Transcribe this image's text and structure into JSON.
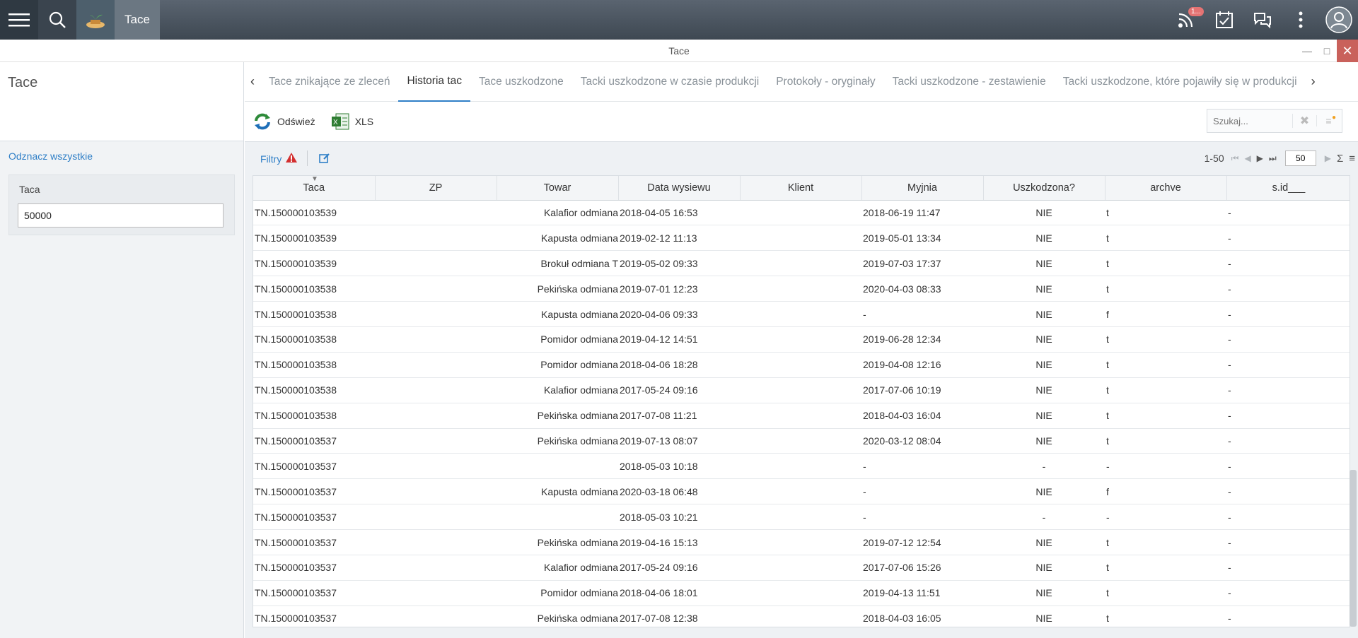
{
  "topbar": {
    "app_tab": "Tace",
    "notification_badge": "1..."
  },
  "window": {
    "title": "Tace"
  },
  "left": {
    "title": "Tace",
    "deselect_all": "Odznacz wszystkie",
    "filter_label": "Taca",
    "filter_value": "50000"
  },
  "tabs": [
    "Tace znikające ze zleceń",
    "Historia tac",
    "Tace uszkodzone",
    "Tacki uszkodzone w czasie produkcji",
    "Protokoły - oryginały",
    "Tacki uszkodzone - zestawienie",
    "Tacki uszkodzone, które pojawiły się w produkcji"
  ],
  "active_tab": 1,
  "toolbar": {
    "refresh_label": "Odśwież",
    "xls_label": "XLS",
    "search_placeholder": "Szukaj..."
  },
  "gridbar": {
    "filters_label": "Filtry",
    "range": "1-50",
    "page_size": "50"
  },
  "columns": [
    "Taca",
    "ZP",
    "Towar",
    "Data wysiewu",
    "Klient",
    "Myjnia",
    "Uszkodzona?",
    "archve",
    "s.id___"
  ],
  "rows": [
    [
      "TN.150000103539",
      "",
      "Kalafior odmiana",
      "2018-04-05 16:53",
      "",
      "2018-06-19 11:47",
      "NIE",
      "t",
      "-"
    ],
    [
      "TN.150000103539",
      "",
      "Kapusta odmiana",
      "2019-02-12 11:13",
      "",
      "2019-05-01 13:34",
      "NIE",
      "t",
      "-"
    ],
    [
      "TN.150000103539",
      "",
      "Brokuł odmiana T",
      "2019-05-02 09:33",
      "",
      "2019-07-03 17:37",
      "NIE",
      "t",
      "-"
    ],
    [
      "TN.150000103538",
      "",
      "Pekińska odmiana",
      "2019-07-01 12:23",
      "",
      "2020-04-03 08:33",
      "NIE",
      "t",
      "-"
    ],
    [
      "TN.150000103538",
      "",
      "Kapusta odmiana",
      "2020-04-06 09:33",
      "",
      "-",
      "NIE",
      "f",
      "-"
    ],
    [
      "TN.150000103538",
      "",
      "Pomidor odmiana",
      "2019-04-12 14:51",
      "",
      "2019-06-28 12:34",
      "NIE",
      "t",
      "-"
    ],
    [
      "TN.150000103538",
      "",
      "Pomidor odmiana",
      "2018-04-06 18:28",
      "",
      "2019-04-08 12:16",
      "NIE",
      "t",
      "-"
    ],
    [
      "TN.150000103538",
      "",
      "Kalafior odmiana",
      "2017-05-24 09:16",
      "",
      "2017-07-06 10:19",
      "NIE",
      "t",
      "-"
    ],
    [
      "TN.150000103538",
      "",
      "Pekińska odmiana",
      "2017-07-08 11:21",
      "",
      "2018-04-03 16:04",
      "NIE",
      "t",
      "-"
    ],
    [
      "TN.150000103537",
      "",
      "Pekińska odmiana",
      "2019-07-13 08:07",
      "",
      "2020-03-12 08:04",
      "NIE",
      "t",
      "-"
    ],
    [
      "TN.150000103537",
      "",
      "",
      "2018-05-03 10:18",
      "",
      "-",
      "-",
      "-",
      "-"
    ],
    [
      "TN.150000103537",
      "",
      "Kapusta odmiana",
      "2020-03-18 06:48",
      "",
      "-",
      "NIE",
      "f",
      "-"
    ],
    [
      "TN.150000103537",
      "",
      "",
      "2018-05-03 10:21",
      "",
      "-",
      "-",
      "-",
      "-"
    ],
    [
      "TN.150000103537",
      "",
      "Pekińska odmiana",
      "2019-04-16 15:13",
      "",
      "2019-07-12 12:54",
      "NIE",
      "t",
      "-"
    ],
    [
      "TN.150000103537",
      "",
      "Kalafior odmiana",
      "2017-05-24 09:16",
      "",
      "2017-07-06 15:26",
      "NIE",
      "t",
      "-"
    ],
    [
      "TN.150000103537",
      "",
      "Pomidor odmiana",
      "2018-04-06 18:01",
      "",
      "2019-04-13 11:51",
      "NIE",
      "t",
      "-"
    ],
    [
      "TN.150000103537",
      "",
      "Pekińska odmiana",
      "2017-07-08 12:38",
      "",
      "2018-04-03 16:05",
      "NIE",
      "t",
      "-"
    ]
  ]
}
